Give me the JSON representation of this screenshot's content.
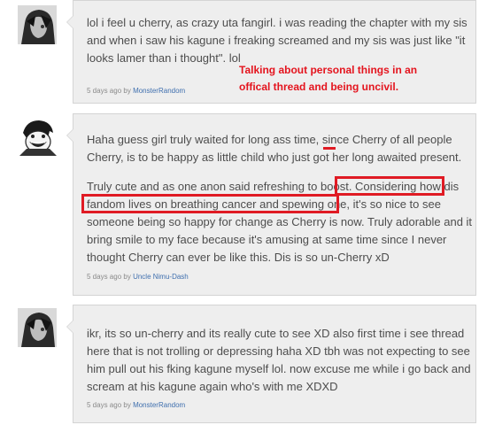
{
  "comments": [
    {
      "author": "MonsterRandom",
      "time": "5 days ago",
      "by": "by",
      "avatar_icon": "manga-avatar-grey",
      "lines": [
        "lol i feel u cherry, as crazy uta fangirl. i was reading the chapter with my sis",
        "and when i saw his kagune i freaking screamed and my sis was just like \"it",
        "looks lamer than i thought\". lol"
      ]
    },
    {
      "author": "Uncle Nimu-Dash",
      "time": "5 days ago",
      "by": "by",
      "avatar_icon": "manga-avatar-grin",
      "lines": [
        "Haha guess girl truly waited for long ass time, since Cherry of all people",
        "Cherry, is to be happy as little child who just got her long awaited present."
      ],
      "lines2": [
        "Truly cute and as one anon said refreshing to boost. Considering how dis",
        "fandom lives on breathing cancer and spewing one, it's so nice to see",
        "someone being so happy for change as Cherry is now. Truly adorable and it",
        "bring smile to my face because it's amusing at same time since I never",
        "thought Cherry can ever be like this. Dis is so un-Cherry xD"
      ]
    },
    {
      "author": "MonsterRandom",
      "time": "5 days ago",
      "by": "by",
      "avatar_icon": "manga-avatar-grey",
      "lines": [
        "ikr, its so un-cherry and its really cute to see XD also first time i see thread",
        "here that is not trolling or depressing haha XD tbh was not expecting to see",
        "him pull out his fking kagune myself lol. now excuse me while i go back and",
        "scream at his kagune again who's with me XDXD"
      ]
    }
  ],
  "annotation": {
    "note_line1": "Talking about personal things in an",
    "note_line2": "offical thread and being uncivil.",
    "color": "#e01b24"
  }
}
